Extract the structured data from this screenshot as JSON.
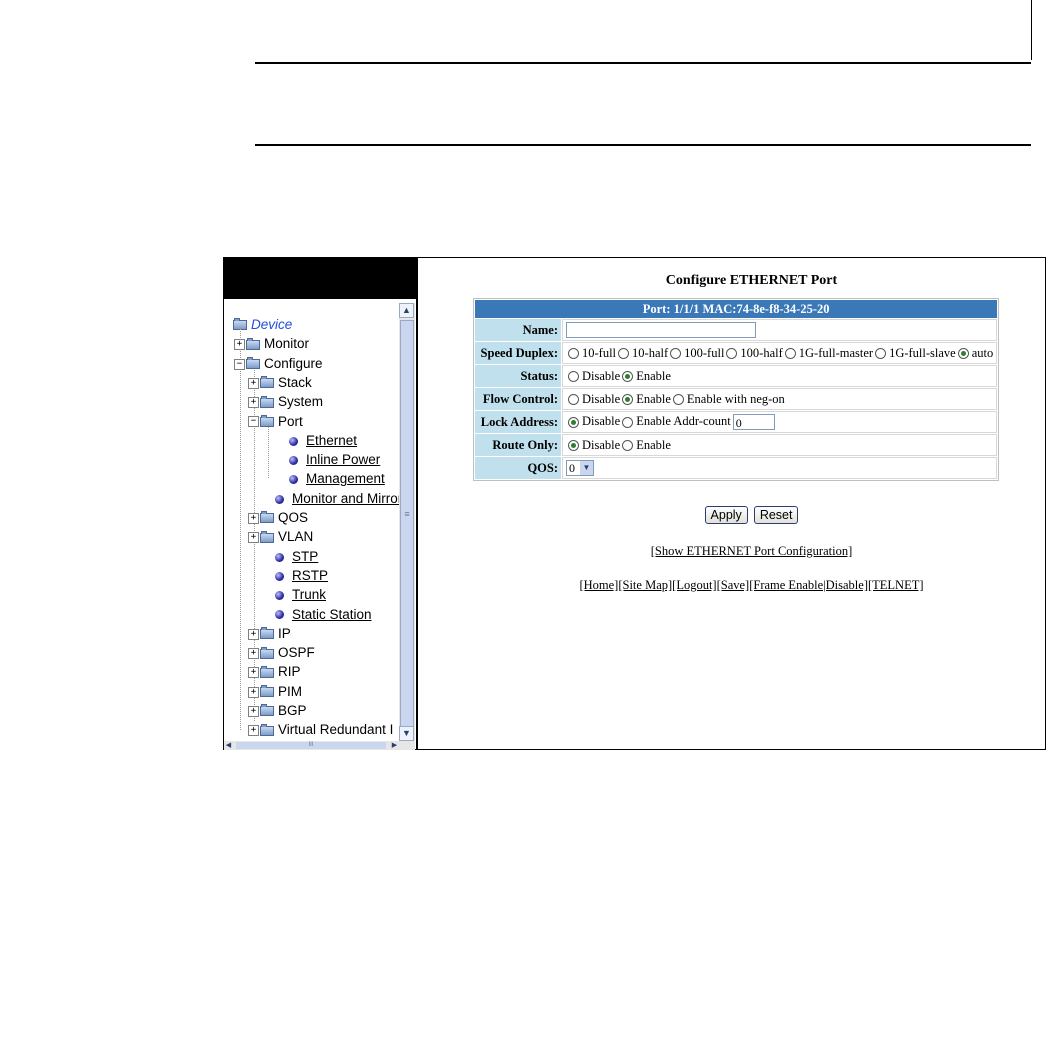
{
  "tree": {
    "root": "Device",
    "items": [
      {
        "label": "Monitor",
        "level": 1,
        "type": "folder",
        "expander": "+"
      },
      {
        "label": "Configure",
        "level": 1,
        "type": "folder",
        "expander": "−"
      },
      {
        "label": "Stack",
        "level": 2,
        "type": "folder",
        "expander": "+"
      },
      {
        "label": "System",
        "level": 2,
        "type": "folder",
        "expander": "+"
      },
      {
        "label": "Port",
        "level": 2,
        "type": "folder",
        "expander": "−"
      },
      {
        "label": "Ethernet",
        "level": 3,
        "type": "link"
      },
      {
        "label": "Inline Power",
        "level": 3,
        "type": "link"
      },
      {
        "label": "Management",
        "level": 3,
        "type": "link"
      },
      {
        "label": "Monitor and Mirror",
        "level": 2,
        "type": "link"
      },
      {
        "label": "QOS",
        "level": 2,
        "type": "folder",
        "expander": "+"
      },
      {
        "label": "VLAN",
        "level": 2,
        "type": "folder",
        "expander": "+"
      },
      {
        "label": "STP",
        "level": 2,
        "type": "link"
      },
      {
        "label": "RSTP",
        "level": 2,
        "type": "link"
      },
      {
        "label": "Trunk",
        "level": 2,
        "type": "link"
      },
      {
        "label": "Static Station",
        "level": 2,
        "type": "link"
      },
      {
        "label": "IP",
        "level": 2,
        "type": "folder",
        "expander": "+"
      },
      {
        "label": "OSPF",
        "level": 2,
        "type": "folder",
        "expander": "+"
      },
      {
        "label": "RIP",
        "level": 2,
        "type": "folder",
        "expander": "+"
      },
      {
        "label": "PIM",
        "level": 2,
        "type": "folder",
        "expander": "+"
      },
      {
        "label": "BGP",
        "level": 2,
        "type": "folder",
        "expander": "+"
      },
      {
        "label": "Virtual Redundant I",
        "level": 2,
        "type": "folder",
        "expander": "+"
      }
    ]
  },
  "form": {
    "title": "Configure ETHERNET Port",
    "header": "Port: 1/1/1 MAC:74-8e-f8-34-25-20",
    "name": {
      "label": "Name:",
      "value": ""
    },
    "speed_duplex": {
      "label": "Speed Duplex:",
      "options": [
        "10-full",
        "10-half",
        "100-full",
        "100-half",
        "1G-full-master",
        "1G-full-slave",
        "auto"
      ],
      "selected": "auto"
    },
    "status": {
      "label": "Status:",
      "options": [
        "Disable",
        "Enable"
      ],
      "selected": "Enable"
    },
    "flow_control": {
      "label": "Flow Control:",
      "options": [
        "Disable",
        "Enable",
        "Enable with neg-on"
      ],
      "selected": "Enable"
    },
    "lock_address": {
      "label": "Lock Address:",
      "options": [
        "Disable",
        "Enable"
      ],
      "selected": "Disable",
      "addr_count_label": "Addr-count",
      "addr_count_value": "0"
    },
    "route_only": {
      "label": "Route Only:",
      "options": [
        "Disable",
        "Enable"
      ],
      "selected": "Disable"
    },
    "qos": {
      "label": "QOS:",
      "value": "0"
    },
    "apply_label": "Apply",
    "reset_label": "Reset",
    "show_config_link": "[Show ETHERNET Port Configuration]",
    "nav_links": "[Home][Site Map][Logout][Save][Frame Enable|Disable][TELNET]"
  },
  "scroll": {
    "up": "▲",
    "down": "▼",
    "left": "◀",
    "right": "▶",
    "grip": "≡",
    "hgrip": "III"
  }
}
